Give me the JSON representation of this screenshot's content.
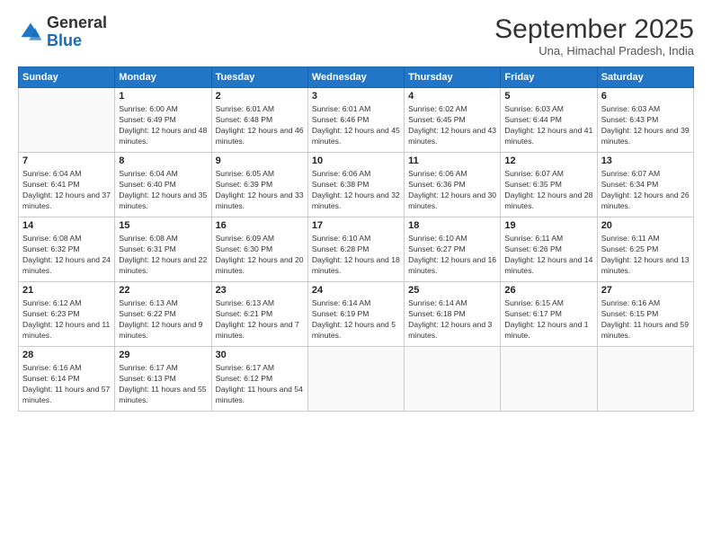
{
  "header": {
    "logo_general": "General",
    "logo_blue": "Blue",
    "title": "September 2025",
    "location": "Una, Himachal Pradesh, India"
  },
  "weekdays": [
    "Sunday",
    "Monday",
    "Tuesday",
    "Wednesday",
    "Thursday",
    "Friday",
    "Saturday"
  ],
  "weeks": [
    [
      {
        "day": "",
        "sunrise": "",
        "sunset": "",
        "daylight": ""
      },
      {
        "day": "1",
        "sunrise": "Sunrise: 6:00 AM",
        "sunset": "Sunset: 6:49 PM",
        "daylight": "Daylight: 12 hours and 48 minutes."
      },
      {
        "day": "2",
        "sunrise": "Sunrise: 6:01 AM",
        "sunset": "Sunset: 6:48 PM",
        "daylight": "Daylight: 12 hours and 46 minutes."
      },
      {
        "day": "3",
        "sunrise": "Sunrise: 6:01 AM",
        "sunset": "Sunset: 6:46 PM",
        "daylight": "Daylight: 12 hours and 45 minutes."
      },
      {
        "day": "4",
        "sunrise": "Sunrise: 6:02 AM",
        "sunset": "Sunset: 6:45 PM",
        "daylight": "Daylight: 12 hours and 43 minutes."
      },
      {
        "day": "5",
        "sunrise": "Sunrise: 6:03 AM",
        "sunset": "Sunset: 6:44 PM",
        "daylight": "Daylight: 12 hours and 41 minutes."
      },
      {
        "day": "6",
        "sunrise": "Sunrise: 6:03 AM",
        "sunset": "Sunset: 6:43 PM",
        "daylight": "Daylight: 12 hours and 39 minutes."
      }
    ],
    [
      {
        "day": "7",
        "sunrise": "Sunrise: 6:04 AM",
        "sunset": "Sunset: 6:41 PM",
        "daylight": "Daylight: 12 hours and 37 minutes."
      },
      {
        "day": "8",
        "sunrise": "Sunrise: 6:04 AM",
        "sunset": "Sunset: 6:40 PM",
        "daylight": "Daylight: 12 hours and 35 minutes."
      },
      {
        "day": "9",
        "sunrise": "Sunrise: 6:05 AM",
        "sunset": "Sunset: 6:39 PM",
        "daylight": "Daylight: 12 hours and 33 minutes."
      },
      {
        "day": "10",
        "sunrise": "Sunrise: 6:06 AM",
        "sunset": "Sunset: 6:38 PM",
        "daylight": "Daylight: 12 hours and 32 minutes."
      },
      {
        "day": "11",
        "sunrise": "Sunrise: 6:06 AM",
        "sunset": "Sunset: 6:36 PM",
        "daylight": "Daylight: 12 hours and 30 minutes."
      },
      {
        "day": "12",
        "sunrise": "Sunrise: 6:07 AM",
        "sunset": "Sunset: 6:35 PM",
        "daylight": "Daylight: 12 hours and 28 minutes."
      },
      {
        "day": "13",
        "sunrise": "Sunrise: 6:07 AM",
        "sunset": "Sunset: 6:34 PM",
        "daylight": "Daylight: 12 hours and 26 minutes."
      }
    ],
    [
      {
        "day": "14",
        "sunrise": "Sunrise: 6:08 AM",
        "sunset": "Sunset: 6:32 PM",
        "daylight": "Daylight: 12 hours and 24 minutes."
      },
      {
        "day": "15",
        "sunrise": "Sunrise: 6:08 AM",
        "sunset": "Sunset: 6:31 PM",
        "daylight": "Daylight: 12 hours and 22 minutes."
      },
      {
        "day": "16",
        "sunrise": "Sunrise: 6:09 AM",
        "sunset": "Sunset: 6:30 PM",
        "daylight": "Daylight: 12 hours and 20 minutes."
      },
      {
        "day": "17",
        "sunrise": "Sunrise: 6:10 AM",
        "sunset": "Sunset: 6:28 PM",
        "daylight": "Daylight: 12 hours and 18 minutes."
      },
      {
        "day": "18",
        "sunrise": "Sunrise: 6:10 AM",
        "sunset": "Sunset: 6:27 PM",
        "daylight": "Daylight: 12 hours and 16 minutes."
      },
      {
        "day": "19",
        "sunrise": "Sunrise: 6:11 AM",
        "sunset": "Sunset: 6:26 PM",
        "daylight": "Daylight: 12 hours and 14 minutes."
      },
      {
        "day": "20",
        "sunrise": "Sunrise: 6:11 AM",
        "sunset": "Sunset: 6:25 PM",
        "daylight": "Daylight: 12 hours and 13 minutes."
      }
    ],
    [
      {
        "day": "21",
        "sunrise": "Sunrise: 6:12 AM",
        "sunset": "Sunset: 6:23 PM",
        "daylight": "Daylight: 12 hours and 11 minutes."
      },
      {
        "day": "22",
        "sunrise": "Sunrise: 6:13 AM",
        "sunset": "Sunset: 6:22 PM",
        "daylight": "Daylight: 12 hours and 9 minutes."
      },
      {
        "day": "23",
        "sunrise": "Sunrise: 6:13 AM",
        "sunset": "Sunset: 6:21 PM",
        "daylight": "Daylight: 12 hours and 7 minutes."
      },
      {
        "day": "24",
        "sunrise": "Sunrise: 6:14 AM",
        "sunset": "Sunset: 6:19 PM",
        "daylight": "Daylight: 12 hours and 5 minutes."
      },
      {
        "day": "25",
        "sunrise": "Sunrise: 6:14 AM",
        "sunset": "Sunset: 6:18 PM",
        "daylight": "Daylight: 12 hours and 3 minutes."
      },
      {
        "day": "26",
        "sunrise": "Sunrise: 6:15 AM",
        "sunset": "Sunset: 6:17 PM",
        "daylight": "Daylight: 12 hours and 1 minute."
      },
      {
        "day": "27",
        "sunrise": "Sunrise: 6:16 AM",
        "sunset": "Sunset: 6:15 PM",
        "daylight": "Daylight: 11 hours and 59 minutes."
      }
    ],
    [
      {
        "day": "28",
        "sunrise": "Sunrise: 6:16 AM",
        "sunset": "Sunset: 6:14 PM",
        "daylight": "Daylight: 11 hours and 57 minutes."
      },
      {
        "day": "29",
        "sunrise": "Sunrise: 6:17 AM",
        "sunset": "Sunset: 6:13 PM",
        "daylight": "Daylight: 11 hours and 55 minutes."
      },
      {
        "day": "30",
        "sunrise": "Sunrise: 6:17 AM",
        "sunset": "Sunset: 6:12 PM",
        "daylight": "Daylight: 11 hours and 54 minutes."
      },
      {
        "day": "",
        "sunrise": "",
        "sunset": "",
        "daylight": ""
      },
      {
        "day": "",
        "sunrise": "",
        "sunset": "",
        "daylight": ""
      },
      {
        "day": "",
        "sunrise": "",
        "sunset": "",
        "daylight": ""
      },
      {
        "day": "",
        "sunrise": "",
        "sunset": "",
        "daylight": ""
      }
    ]
  ]
}
